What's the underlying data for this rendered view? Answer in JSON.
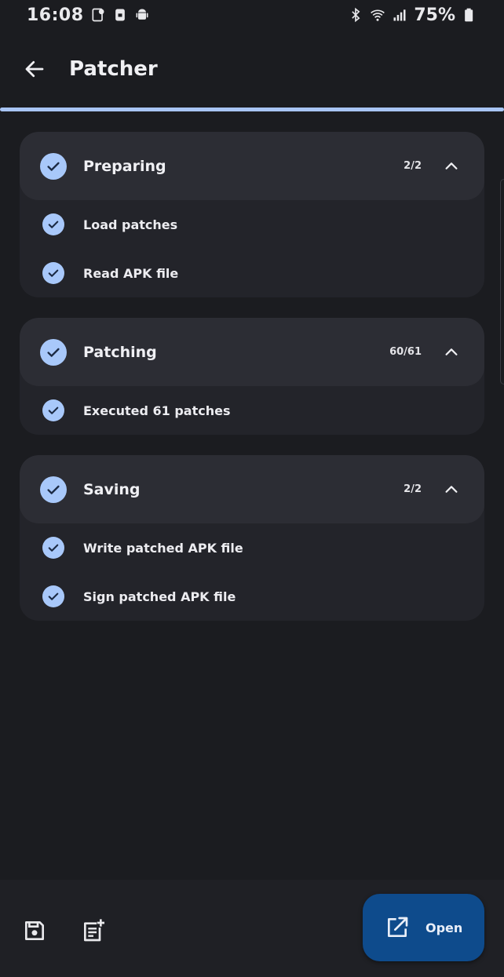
{
  "status_bar": {
    "time": "16:08",
    "battery": "75%"
  },
  "app_bar": {
    "title": "Patcher"
  },
  "progress": {
    "value": 1.0
  },
  "sections": [
    {
      "title": "Preparing",
      "count": "2/2",
      "steps": [
        "Load patches",
        "Read APK file"
      ]
    },
    {
      "title": "Patching",
      "count": "60/61",
      "steps": [
        "Executed 61 patches"
      ]
    },
    {
      "title": "Saving",
      "count": "2/2",
      "steps": [
        "Write patched APK file",
        "Sign patched APK file"
      ]
    }
  ],
  "bottom_bar": {
    "open_label": "Open"
  },
  "colors": {
    "background": "#1b1c20",
    "accent": "#a8c8fa",
    "fab": "#0e4b8c"
  }
}
